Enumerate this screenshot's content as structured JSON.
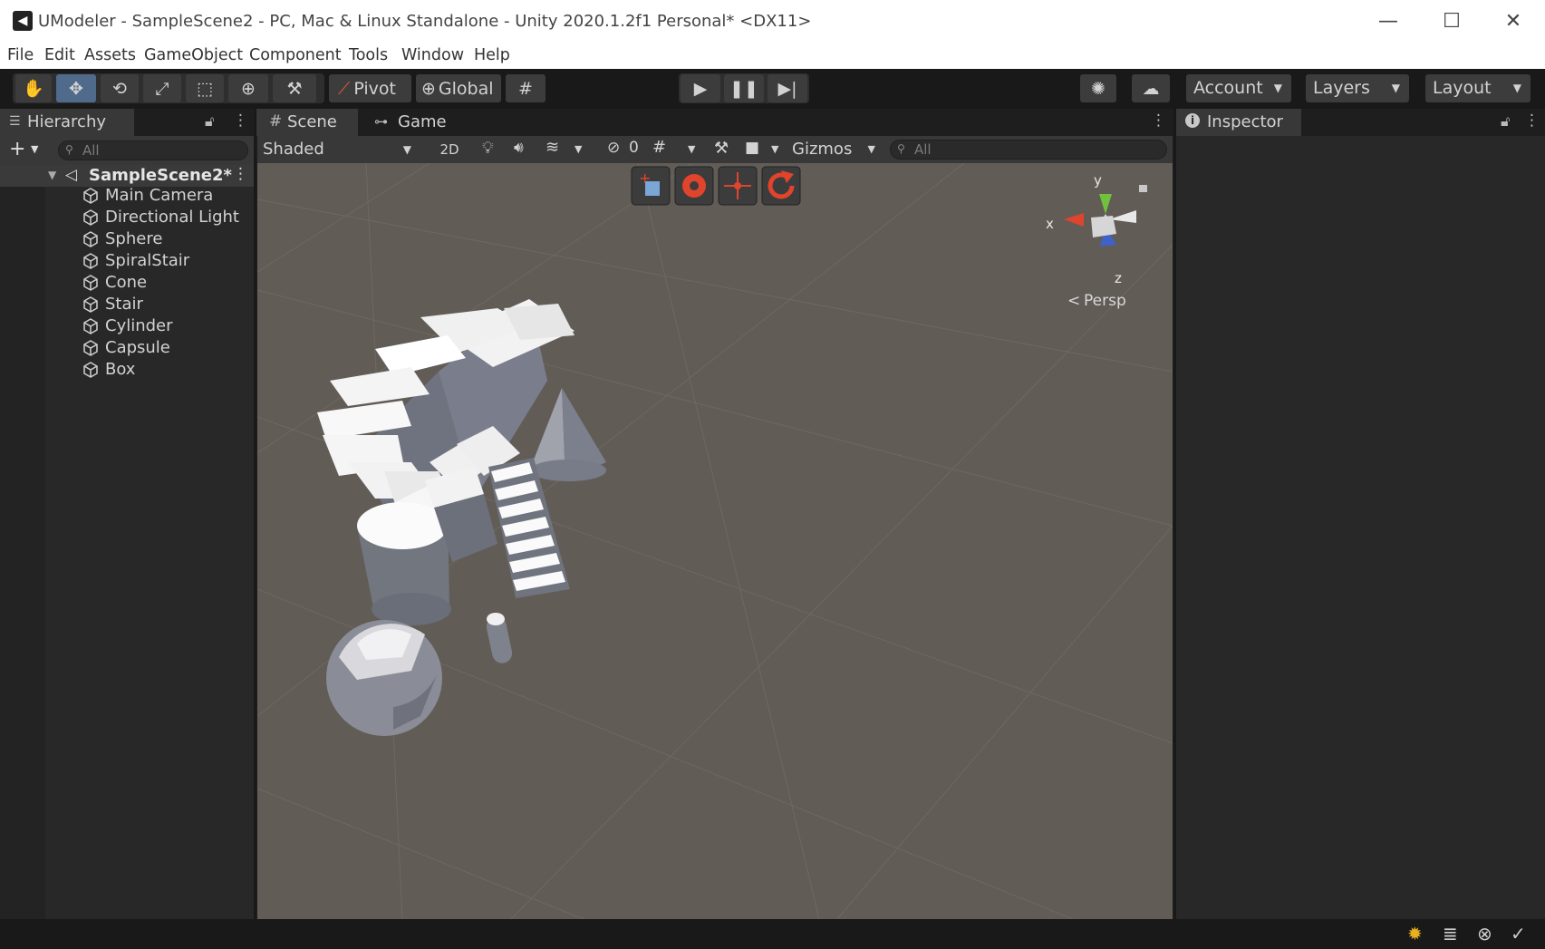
{
  "window": {
    "title": "UModeler - SampleScene2 - PC, Mac & Linux Standalone - Unity 2020.1.2f1 Personal* <DX11>",
    "minimize": "—",
    "maximize": "☐",
    "close": "✕"
  },
  "menu": [
    "File",
    "Edit",
    "Assets",
    "GameObject",
    "Component",
    "Tools",
    "Window",
    "Help"
  ],
  "toolbar": {
    "pivot_label": "Pivot",
    "global_label": "Global",
    "account_label": "Account",
    "layers_label": "Layers",
    "layout_label": "Layout"
  },
  "hierarchy": {
    "tab_label": "Hierarchy",
    "search_placeholder": "All",
    "scene_name": "SampleScene2*",
    "items": [
      "Main Camera",
      "Directional Light",
      "Sphere",
      "SpiralStair",
      "Cone",
      "Stair",
      "Cylinder",
      "Capsule",
      "Box"
    ]
  },
  "scene": {
    "scene_tab_label": "Scene",
    "game_tab_label": "Game",
    "shading_mode": "Shaded",
    "twod_label": "2D",
    "hidden_count": "0",
    "gizmos_label": "Gizmos",
    "search_placeholder": "All",
    "projection_label": "Persp",
    "axis_labels": {
      "x": "x",
      "y": "y",
      "z": "z"
    }
  },
  "inspector": {
    "tab_label": "Inspector"
  },
  "colors": {
    "accent": "#4f6a8a",
    "scene_bg": "#605a55",
    "panel_bg": "#282828",
    "umodeler_red": "#e0442c"
  }
}
